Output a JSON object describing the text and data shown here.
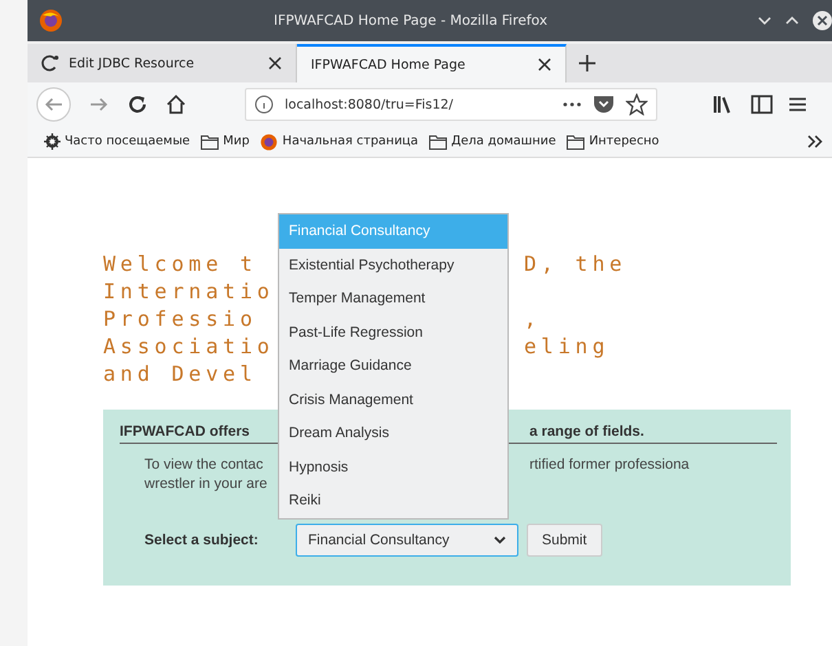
{
  "window": {
    "title": "IFPWAFCAD Home Page - Mozilla Firefox"
  },
  "tabs": [
    {
      "label": "Edit JDBC Resource",
      "selected": false,
      "icon": true
    },
    {
      "label": "IFPWAFCAD Home Page",
      "selected": true,
      "icon": false
    }
  ],
  "address": "localhost:8080/tru=Fis12/",
  "bookmarks": [
    {
      "label": "Часто посещаемые",
      "kind": "gear"
    },
    {
      "label": "Мир",
      "kind": "folder"
    },
    {
      "label": "Начальная страница",
      "kind": "firefox"
    },
    {
      "label": "Дела домашние",
      "kind": "folder"
    },
    {
      "label": "Интересно",
      "kind": "folder"
    }
  ],
  "heading_lines": [
    {
      "left": "Welcome t",
      "right": "D, the"
    },
    {
      "left": "Internatio"
    },
    {
      "left": "Professio",
      "right": ","
    },
    {
      "left": "Associatio",
      "right": "eling"
    },
    {
      "left": "and Devel"
    }
  ],
  "box": {
    "heading_left": "IFPWAFCAD offers",
    "heading_right": "a range of fields.",
    "paragraph_lines": [
      {
        "left": "To view the contac",
        "right": "rtified former professiona"
      },
      {
        "left": "wrestler in your are"
      }
    ],
    "select_label": "Select a subject:",
    "select_value": "Financial Consultancy",
    "submit": "Submit"
  },
  "dropdown": [
    {
      "label": "Financial Consultancy",
      "selected": true
    },
    {
      "label": "Existential Psychotherapy",
      "selected": false
    },
    {
      "label": "Temper Management",
      "selected": false
    },
    {
      "label": "Past-Life Regression",
      "selected": false
    },
    {
      "label": "Marriage Guidance",
      "selected": false
    },
    {
      "label": "Crisis Management",
      "selected": false
    },
    {
      "label": "Dream Analysis",
      "selected": false
    },
    {
      "label": "Hypnosis",
      "selected": false
    },
    {
      "label": "Reiki",
      "selected": false
    }
  ]
}
